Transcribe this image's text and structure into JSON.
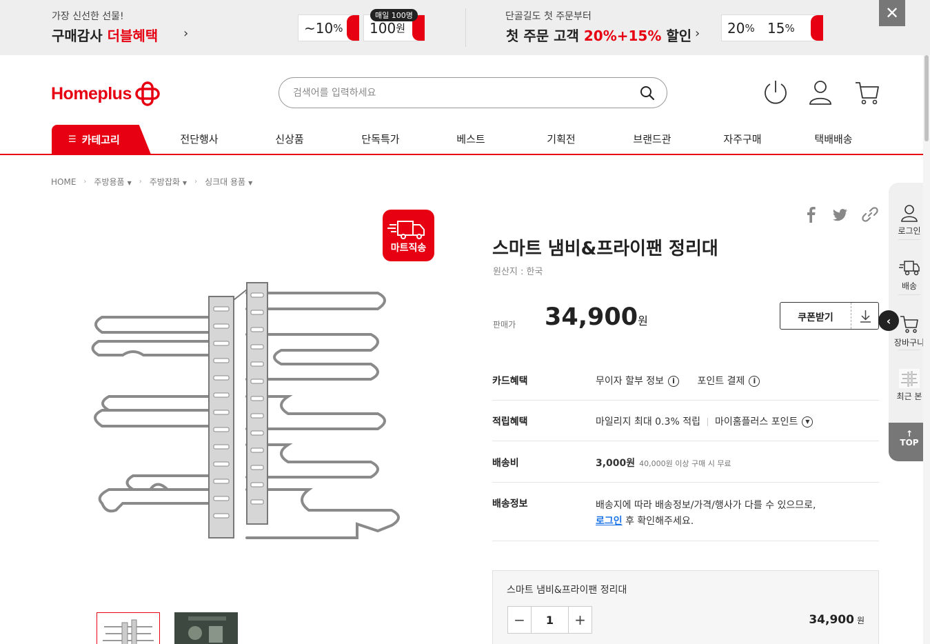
{
  "promo": {
    "left_line1": "가장 신선한 선물!",
    "left_line2a": "구매감사 ",
    "left_line2b": "더블혜택",
    "coupon1": "~10",
    "coupon1_unit": "%",
    "daily_badge": "매일 100명",
    "coupon2": "100",
    "coupon2_unit": "원",
    "right_line1": "단골길도 첫 주문부터",
    "right_line2a": "첫 주문 고객 ",
    "right_line2b": "20%+15%",
    "right_line2c": " 할인",
    "coupon3": "20",
    "coupon4": "15",
    "pct": "%",
    "close": "✕"
  },
  "header": {
    "logo": "Homeplus",
    "search_placeholder": "검색어를 입력하세요"
  },
  "nav": {
    "category": "카테고리",
    "items": [
      "전단행사",
      "신상품",
      "단독특가",
      "베스트",
      "기획전",
      "브랜드관",
      "자주구매",
      "택배배송"
    ]
  },
  "breadcrumb": [
    "HOME",
    "주방용품",
    "주방잡화",
    "싱크대 용품"
  ],
  "product": {
    "badge": "마트직송",
    "title": "스마트 냄비&프라이팬 정리대",
    "origin": "원산지 : 한국",
    "price_label": "판매가",
    "price": "34,900",
    "won": "원",
    "coupon_button": "쿠폰받기"
  },
  "benefits": {
    "card_label": "카드혜택",
    "card_v1": "무이자 할부 정보",
    "card_v2": "포인트 결제",
    "point_label": "적립혜택",
    "point_v1": "마일리지 최대 0.3% 적립",
    "point_v2": "마이홈플러스 포인트",
    "ship_label": "배송비",
    "ship_fee": "3,000원",
    "ship_free": "40,000원 이상 구매 시 무료",
    "shipinfo_label": "배송정보",
    "shipinfo_line1": "배송지에 따라 배송정보/가격/행사가 다를 수 있으므로,",
    "shipinfo_link": "로그인",
    "shipinfo_line2": " 후 확인해주세요."
  },
  "option": {
    "name": "스마트 냄비&프라이팬 정리대",
    "qty": "1",
    "minus": "−",
    "plus": "+",
    "amount": "34,900",
    "won": "원"
  },
  "quickbar": {
    "login": "로그인",
    "delivery": "배송",
    "cart": "장바구니",
    "recent": "최근 본",
    "top": "TOP"
  },
  "colors": {
    "brand_red": "#e60012",
    "link_blue": "#1a73e8"
  }
}
